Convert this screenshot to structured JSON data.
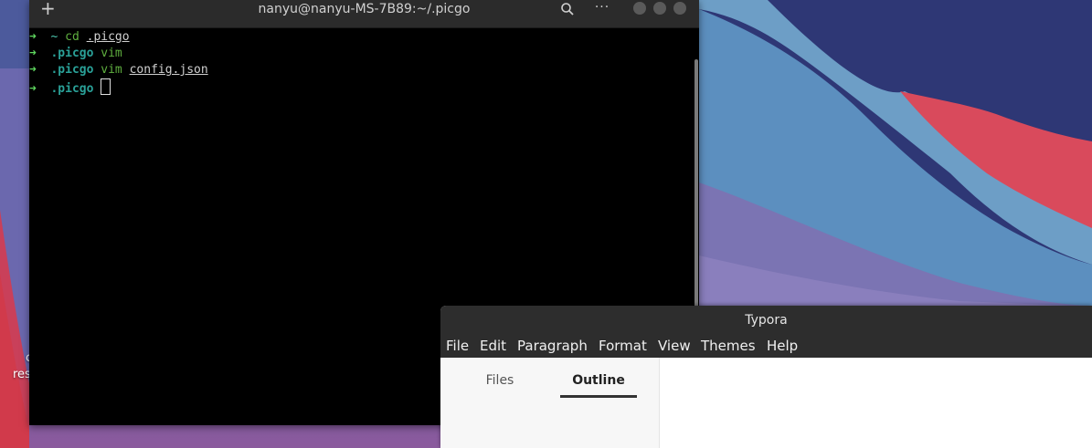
{
  "desktop": {
    "label_line1": "c",
    "label_line2": "res"
  },
  "terminal": {
    "title": "nanyu@nanyu-MS-7B89:~/.picgo",
    "icons": {
      "new_tab": "plus-icon",
      "search": "search-icon",
      "menu": "ellipsis-icon"
    },
    "prompt_arrow": "➜",
    "lines": [
      {
        "dir": "~",
        "cmd": "cd",
        "arg": ".picgo"
      },
      {
        "dir": ".picgo",
        "cmd": "vim",
        "arg": ""
      },
      {
        "dir": ".picgo",
        "cmd": "vim",
        "arg": "config.json"
      },
      {
        "dir": ".picgo",
        "cmd": "",
        "arg": ""
      }
    ]
  },
  "typora": {
    "title": "Typora",
    "menu": [
      "File",
      "Edit",
      "Paragraph",
      "Format",
      "View",
      "Themes",
      "Help"
    ],
    "tabs": {
      "files": "Files",
      "outline": "Outline"
    },
    "active_tab": "Outline"
  },
  "colors": {
    "terminal_bg": "#000000",
    "prompt_arrow": "#5fd75f",
    "dir": "#2aa198",
    "cmd": "#5faf3f",
    "typora_bar": "#2d2d2d"
  }
}
